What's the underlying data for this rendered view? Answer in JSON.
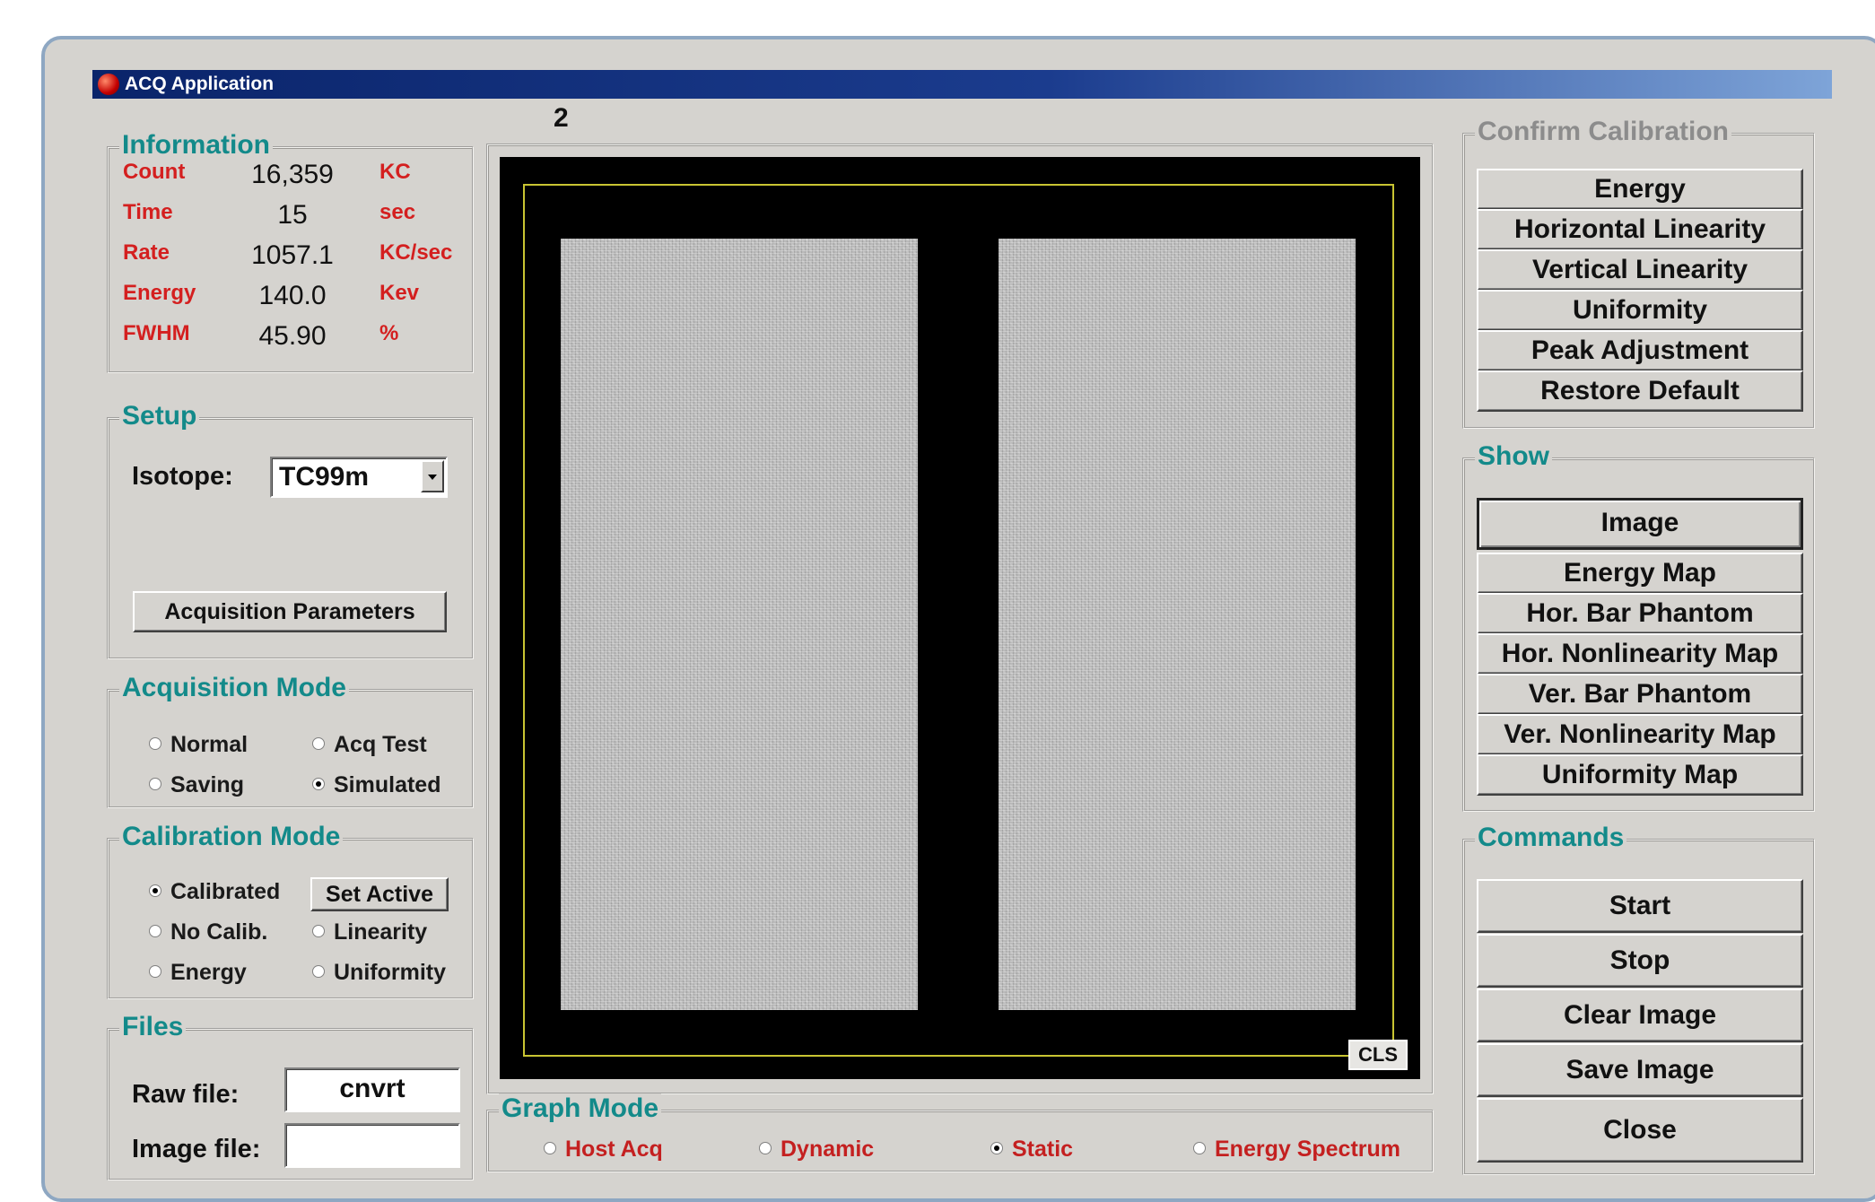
{
  "window": {
    "title": "ACQ Application"
  },
  "image_panel": {
    "frame_number": "2",
    "cls_label": "CLS"
  },
  "information": {
    "legend": "Information",
    "rows": [
      {
        "name": "Count",
        "value": "16,359",
        "unit": "KC"
      },
      {
        "name": "Time",
        "value": "15",
        "unit": "sec"
      },
      {
        "name": "Rate",
        "value": "1057.1",
        "unit": "KC/sec"
      },
      {
        "name": "Energy",
        "value": "140.0",
        "unit": "Kev"
      },
      {
        "name": "FWHM",
        "value": "45.90",
        "unit": "%"
      }
    ]
  },
  "setup": {
    "legend": "Setup",
    "isotope_label": "Isotope:",
    "isotope_value": "TC99m",
    "acq_params_button": "Acquisition Parameters"
  },
  "acquisition_mode": {
    "legend": "Acquisition Mode",
    "options": [
      {
        "label": "Normal",
        "selected": false
      },
      {
        "label": "Acq Test",
        "selected": false
      },
      {
        "label": "Saving",
        "selected": false
      },
      {
        "label": "Simulated",
        "selected": true
      }
    ]
  },
  "calibration_mode": {
    "legend": "Calibration Mode",
    "set_active_button": "Set Active",
    "options": [
      {
        "label": "Calibrated",
        "selected": true
      },
      {
        "label": "No Calib.",
        "selected": false
      },
      {
        "label": "Linearity",
        "selected": false
      },
      {
        "label": "Energy",
        "selected": false
      },
      {
        "label": "Uniformity",
        "selected": false
      }
    ]
  },
  "files": {
    "legend": "Files",
    "raw_label": "Raw file:",
    "raw_value": "cnvrt",
    "image_label": "Image file:",
    "image_value": ""
  },
  "graph_mode": {
    "legend": "Graph Mode",
    "options": [
      {
        "label": "Host Acq",
        "selected": false
      },
      {
        "label": "Dynamic",
        "selected": false
      },
      {
        "label": "Static",
        "selected": true
      },
      {
        "label": "Energy Spectrum",
        "selected": false
      }
    ]
  },
  "confirm_calibration": {
    "legend": "Confirm Calibration",
    "buttons": [
      "Energy",
      "Horizontal Linearity",
      "Vertical Linearity",
      "Uniformity",
      "Peak Adjustment",
      "Restore Default"
    ]
  },
  "show": {
    "legend": "Show",
    "active": "Image",
    "buttons": [
      "Image",
      "Energy Map",
      "Hor. Bar Phantom",
      "Hor. Nonlinearity Map",
      "Ver. Bar Phantom",
      "Ver. Nonlinearity Map",
      "Uniformity Map"
    ]
  },
  "commands": {
    "legend": "Commands",
    "buttons": [
      "Start",
      "Stop",
      "Clear Image",
      "Save Image",
      "Close"
    ]
  },
  "colors": {
    "legend_teal": "#138a8a",
    "value_red": "#d41f1f",
    "title_blue": "#0a246a",
    "window_gray": "#d5d3cf"
  }
}
